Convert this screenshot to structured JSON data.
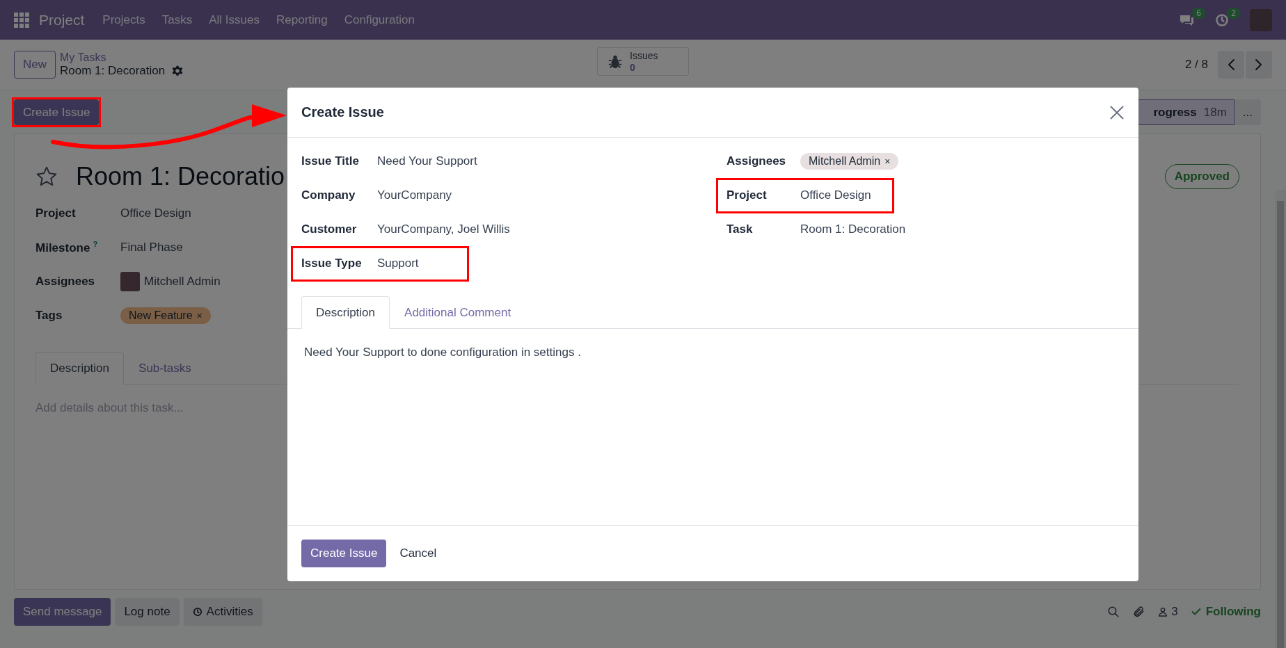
{
  "navbar": {
    "app_name": "Project",
    "menu": [
      "Projects",
      "Tasks",
      "All Issues",
      "Reporting",
      "Configuration"
    ],
    "messages_count": "6",
    "activities_count": "2"
  },
  "control_panel": {
    "new_button": "New",
    "breadcrumb": "My Tasks",
    "record_title": "Room 1: Decoration",
    "smart_button": {
      "label": "Issues",
      "count": "0"
    },
    "pager": "2 / 8"
  },
  "action_bar": {
    "create_issue_button": {
      "label": "Create Issue",
      "highlighted": true
    },
    "stage": {
      "label": "rogress",
      "duration": "18m",
      "selected": true
    },
    "more_stages": "..."
  },
  "task": {
    "starred": false,
    "title": "Room 1: Decoratio",
    "status_badge": "Approved",
    "fields": [
      {
        "label": "Project",
        "value": "Office Design",
        "kind": "text"
      },
      {
        "label": "Milestone",
        "help": "?",
        "value": "Final Phase",
        "kind": "text"
      },
      {
        "label": "Assignees",
        "value": "Mitchell Admin",
        "kind": "user"
      },
      {
        "label": "Tags",
        "value": "New Feature",
        "kind": "tag",
        "remove_icon": "×"
      }
    ],
    "tabs": [
      {
        "label": "Description",
        "selected": true
      },
      {
        "label": "Sub-tasks",
        "selected": false
      }
    ],
    "description_placeholder": "Add details about this task..."
  },
  "chatter": {
    "buttons": [
      {
        "label": "Send message",
        "kind": "primary"
      },
      {
        "label": "Log note",
        "kind": "secondary"
      },
      {
        "label": "Activities",
        "kind": "activities"
      }
    ],
    "followers_count": "3",
    "following": "Following"
  },
  "dialog": {
    "title": "Create Issue",
    "left_fields": [
      {
        "label": "Issue Title",
        "value": "Need Your Support",
        "kind": "text",
        "highlighted": false
      },
      {
        "label": "Company",
        "value": "YourCompany",
        "kind": "text",
        "highlighted": false
      },
      {
        "label": "Customer",
        "value": "YourCompany, Joel Willis",
        "kind": "text",
        "highlighted": false
      },
      {
        "label": "Issue Type",
        "value": "Support",
        "kind": "text",
        "highlighted": true
      }
    ],
    "right_fields": [
      {
        "label": "Assignees",
        "value": "Mitchell Admin",
        "kind": "tag",
        "remove_icon": "×",
        "highlighted": false
      },
      {
        "label": "Project",
        "value": "Office Design",
        "kind": "text",
        "highlighted": true
      },
      {
        "label": "Task",
        "value": "Room 1: Decoration",
        "kind": "text",
        "highlighted": false
      }
    ],
    "tabs": [
      {
        "label": "Description",
        "selected": true
      },
      {
        "label": "Additional Comment",
        "selected": false
      }
    ],
    "description": "Need Your Support to done configuration in settings .",
    "buttons": [
      {
        "label": "Create Issue",
        "kind": "primary"
      },
      {
        "label": "Cancel",
        "kind": "link"
      }
    ]
  }
}
